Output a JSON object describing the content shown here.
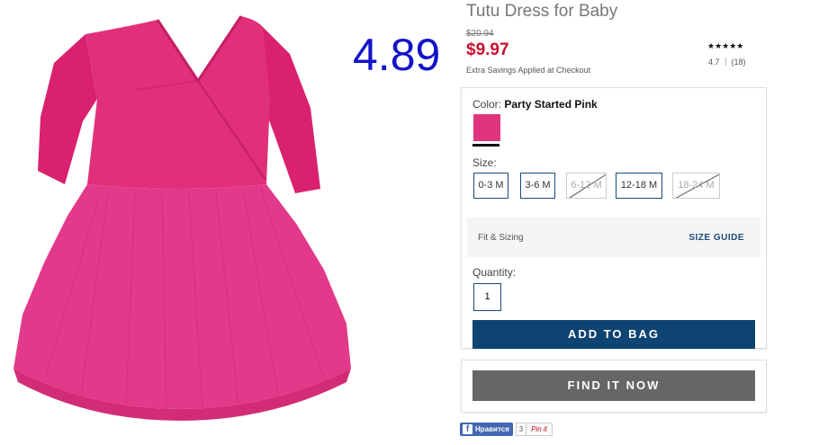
{
  "product": {
    "title": "Tutu Dress for Baby",
    "overlay_price": "4.89",
    "original_price": "$20.94",
    "sale_price": "$9.97",
    "savings_note": "Extra Savings Applied at Checkout",
    "rating": {
      "stars": "★★★★★",
      "value": "4.7",
      "count": "(18)"
    },
    "image_icon": "pink-tutu-dress-image"
  },
  "options": {
    "color_label": "Color:",
    "color_value": "Party Started Pink",
    "swatch_color": "#e0347f",
    "size_label": "Size:",
    "sizes": [
      {
        "label": "0-3 M",
        "available": true
      },
      {
        "label": "3-6 M",
        "available": true
      },
      {
        "label": "6-12 M",
        "available": false
      },
      {
        "label": "12-18 M",
        "available": true
      },
      {
        "label": "18-24 M",
        "available": false
      }
    ],
    "fit_label": "Fit & Sizing",
    "size_guide": "SIZE GUIDE",
    "quantity_label": "Quantity:",
    "quantity_value": "1",
    "add_to_bag": "ADD TO BAG"
  },
  "find_it_now": "FIND IT NOW",
  "social": {
    "fb_label": "Нравится",
    "fb_icon": "f",
    "fb_count": "3",
    "pin_label": "Pin it"
  },
  "colors": {
    "accent_blue": "#0e4472",
    "sale_red": "#c8102e",
    "overlay_blue": "#1313c8",
    "dress_pink": "#e0347f"
  }
}
